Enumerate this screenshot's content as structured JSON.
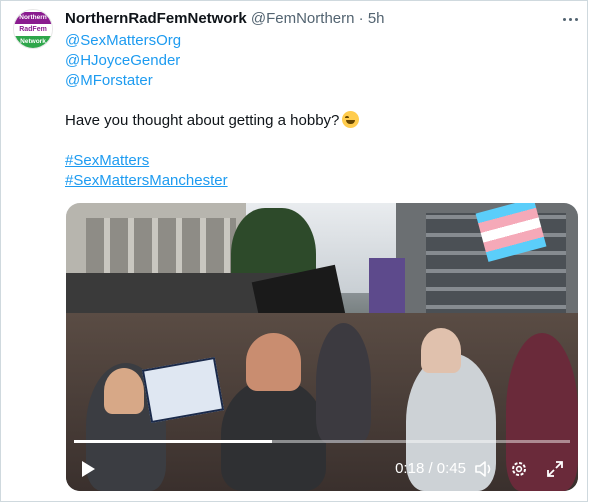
{
  "tweet": {
    "avatar": {
      "line1": "Northern",
      "line2": "RadFem",
      "line3": "Network",
      "colors": {
        "top": "#8a1b8f",
        "bottom": "#2ea64b"
      }
    },
    "display_name": "NorthernRadFemNetwork",
    "handle": "@FemNorthern",
    "separator": "·",
    "time": "5h",
    "mentions": [
      "@SexMattersOrg",
      "@HJoyceGender",
      "@MForstater"
    ],
    "text": "Have you thought about getting a hobby?",
    "emoji": "face-with-tears-of-joy",
    "hashtags": [
      "#SexMatters",
      "#SexMattersManchester"
    ]
  },
  "video": {
    "current_time": "0:18",
    "duration": "0:45",
    "timecode": "0:18 / 0:45",
    "progress_percent": 40,
    "icons": [
      "play-icon",
      "volume-icon",
      "settings-icon",
      "fullscreen-icon"
    ]
  },
  "colors": {
    "link": "#1d9bf0",
    "text": "#0f1419",
    "secondary": "#536471",
    "border": "#cfd9de"
  }
}
